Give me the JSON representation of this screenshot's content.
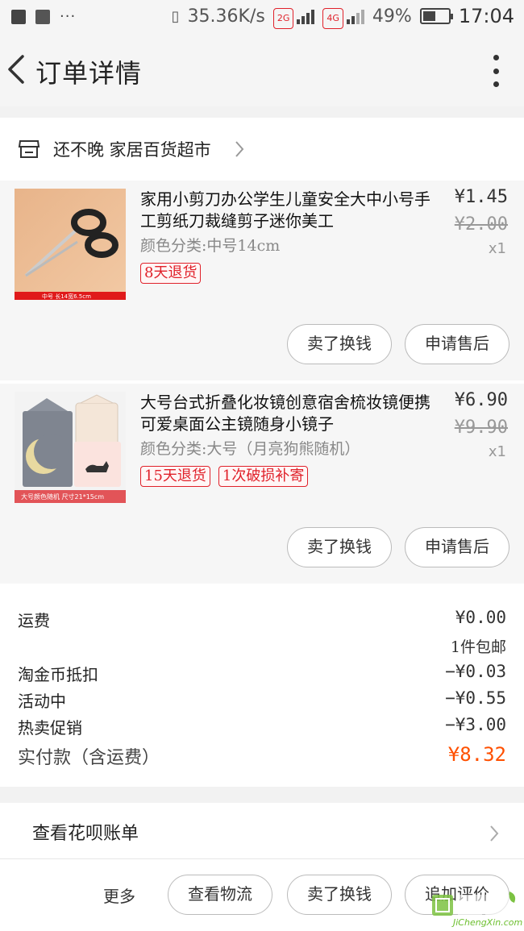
{
  "status_bar": {
    "speed": "35.36K/s",
    "net1": "2G",
    "net2": "4G",
    "battery": "49%",
    "time": "17:04"
  },
  "header": {
    "title": "订单详情"
  },
  "store": {
    "name": "还不晚 家居百货超市"
  },
  "items": [
    {
      "title": "家用小剪刀办公学生儿童安全大中小号手工剪纸刀裁缝剪子迷你美工",
      "spec": "颜色分类:中号14cm",
      "image_caption": "中号 长14宽6.5cm",
      "tags": [
        "8天退货"
      ],
      "price": "¥1.45",
      "original_price": "¥2.00",
      "quantity": "x1",
      "sell_label": "卖了换钱",
      "after_sale_label": "申请售后"
    },
    {
      "title": "大号台式折叠化妆镜创意宿舍梳妆镜便携可爱桌面公主镜随身小镜子",
      "spec": "颜色分类:大号（月亮狗熊随机）",
      "image_caption": "大号颜色随机 尺寸21*15cm",
      "tags": [
        "15天退货",
        "1次破损补寄"
      ],
      "price": "¥6.90",
      "original_price": "¥9.90",
      "quantity": "x1",
      "sell_label": "卖了换钱",
      "after_sale_label": "申请售后"
    }
  ],
  "summary": {
    "shipping_label": "运费",
    "shipping_value": "¥0.00",
    "shipping_note": "1件包邮",
    "coin_label": "淘金币抵扣",
    "coin_value": "−¥0.03",
    "activity_label": "活动中",
    "activity_value": "−¥0.55",
    "promo_label": "热卖促销",
    "promo_value": "−¥3.00",
    "total_label": "实付款（含运费）",
    "total_value": "¥8.32"
  },
  "huabei": {
    "label": "查看花呗账单"
  },
  "bottom_bar": {
    "more_label": "更多",
    "logistics_label": "查看物流",
    "sell_label": "卖了换钱",
    "review_label": "追加评价"
  },
  "watermark": {
    "text": "JiChengXin.com"
  },
  "colors": {
    "accent_orange": "#ff5000",
    "tag_red": "#e0212a"
  }
}
